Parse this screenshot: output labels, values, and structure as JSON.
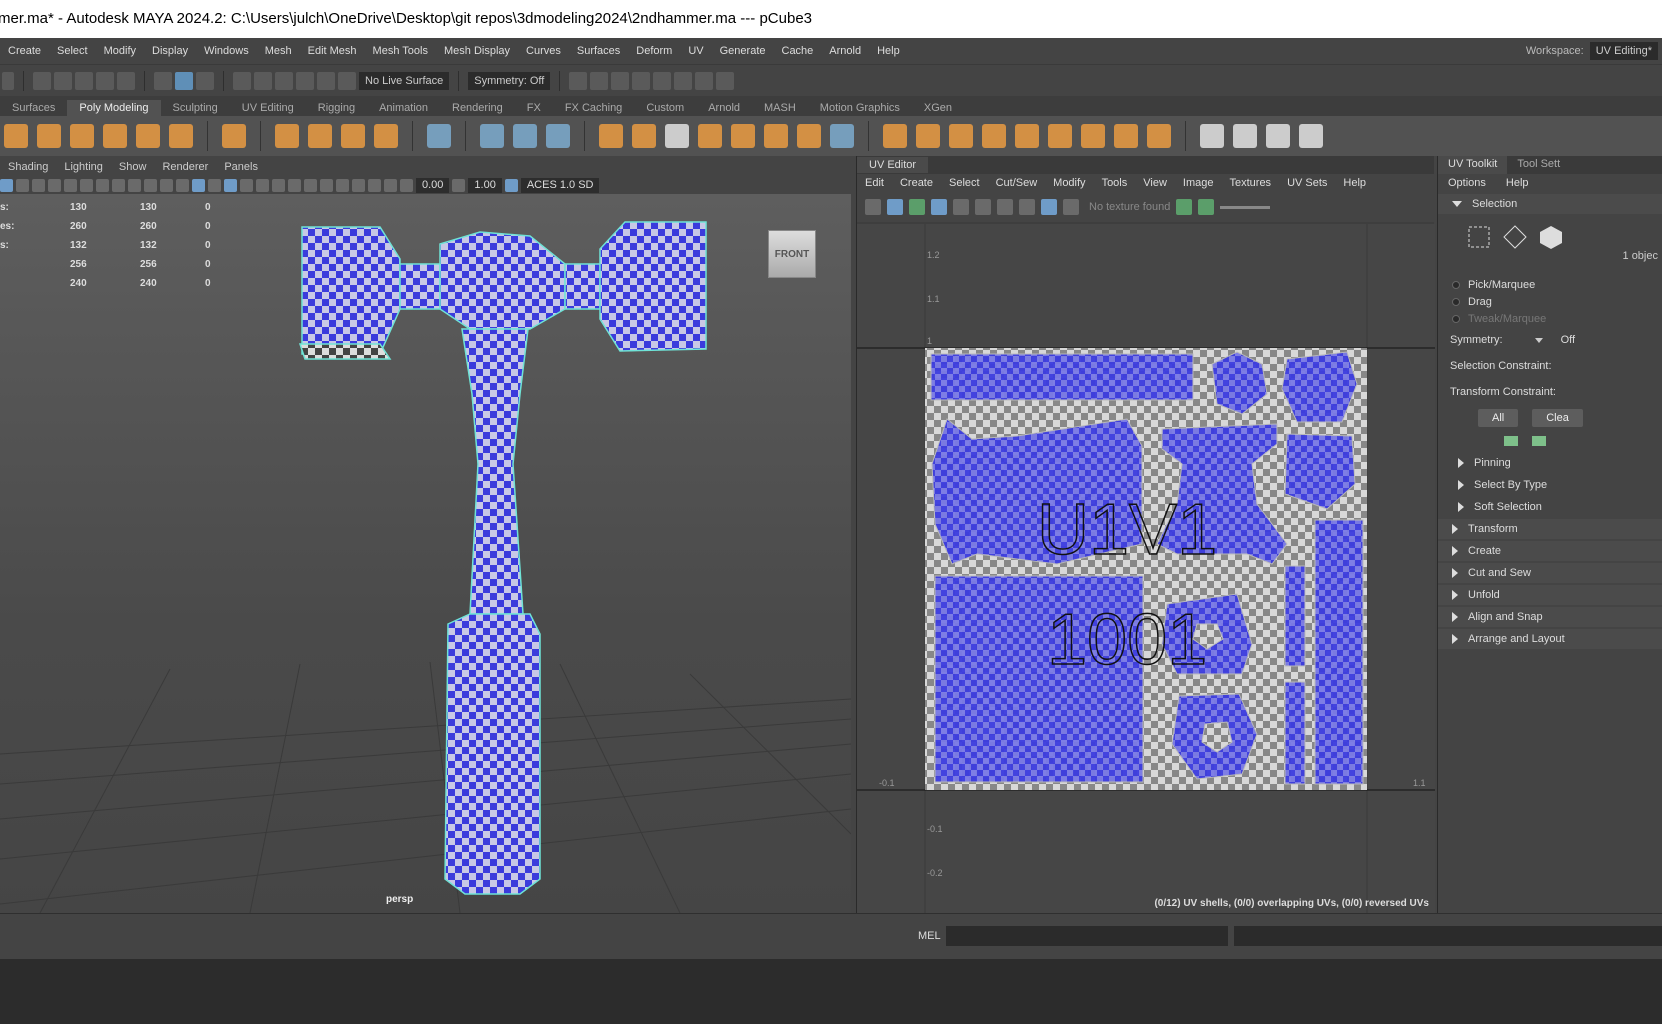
{
  "window": {
    "title": "mer.ma* - Autodesk MAYA 2024.2: C:\\Users\\julch\\OneDrive\\Desktop\\git repos\\3dmodeling2024\\2ndhammer.ma   ---   pCube3"
  },
  "main_menu": [
    "Create",
    "Select",
    "Modify",
    "Display",
    "Windows",
    "Mesh",
    "Edit Mesh",
    "Mesh Tools",
    "Mesh Display",
    "Curves",
    "Surfaces",
    "Deform",
    "UV",
    "Generate",
    "Cache",
    "Arnold",
    "Help"
  ],
  "workspace": {
    "label": "Workspace:",
    "value": "UV Editing*"
  },
  "status_line": {
    "live_surface": "No Live Surface",
    "symmetry": "Symmetry: Off"
  },
  "shelf_tabs": [
    "Surfaces",
    "Poly Modeling",
    "Sculpting",
    "UV Editing",
    "Rigging",
    "Animation",
    "Rendering",
    "FX",
    "FX Caching",
    "Custom",
    "Arnold",
    "MASH",
    "Motion Graphics",
    "XGen"
  ],
  "shelf_active_tab": "Poly Modeling",
  "viewport": {
    "menu": [
      "Shading",
      "Lighting",
      "Show",
      "Renderer",
      "Panels"
    ],
    "fields": {
      "value_a": "0.00",
      "value_b": "1.00",
      "color_space": "ACES 1.0 SD"
    },
    "hud_rows": [
      [
        "s:",
        "130",
        "130",
        "0"
      ],
      [
        "es:",
        "260",
        "260",
        "0"
      ],
      [
        "s:",
        "132",
        "132",
        "0"
      ],
      [
        "",
        "256",
        "256",
        "0"
      ],
      [
        "",
        "240",
        "240",
        "0"
      ]
    ],
    "view_cube": "FRONT",
    "camera": "persp"
  },
  "uv_editor": {
    "title": "UV Editor",
    "menu": [
      "Edit",
      "Create",
      "Select",
      "Cut/Sew",
      "Modify",
      "Tools",
      "View",
      "Image",
      "Textures",
      "UV Sets",
      "Help"
    ],
    "texture_status": "No texture found",
    "tile_label_top": "U1V1",
    "tile_label_bottom": "1001",
    "axis_labels": {
      "v_1_2": "1.2",
      "v_1_1": "1.1",
      "v_1": "1",
      "u_neg": "-0.1",
      "u_1_1": "1.1",
      "v_neg_1": "-0.1",
      "v_neg_2": "-0.2"
    },
    "status": "(0/12) UV shells, (0/0) overlapping UVs, (0/0) reversed UVs"
  },
  "uv_toolkit": {
    "tabs": [
      "UV Toolkit",
      "Tool Sett"
    ],
    "menu": [
      "Options",
      "Help"
    ],
    "selection_header": "Selection",
    "objects_count": "1 objec",
    "modes": [
      "Pick/Marquee",
      "Drag",
      "Tweak/Marquee"
    ],
    "symmetry_label": "Symmetry:",
    "symmetry_value": "Off",
    "selection_constraint": "Selection Constraint:",
    "transform_constraint": "Transform Constraint:",
    "btn_all": "All",
    "btn_clear": "Clea",
    "subsections": [
      "Pinning",
      "Select By Type",
      "Soft Selection"
    ],
    "sections": [
      "Transform",
      "Create",
      "Cut and Sew",
      "Unfold",
      "Align and Snap",
      "Arrange and Layout"
    ]
  },
  "command_line": {
    "label": "MEL"
  },
  "colors": {
    "uv_blue": "#3b3bdc",
    "wire": "#6fe3d6",
    "panel": "#444444",
    "active_tab": "#525252"
  }
}
